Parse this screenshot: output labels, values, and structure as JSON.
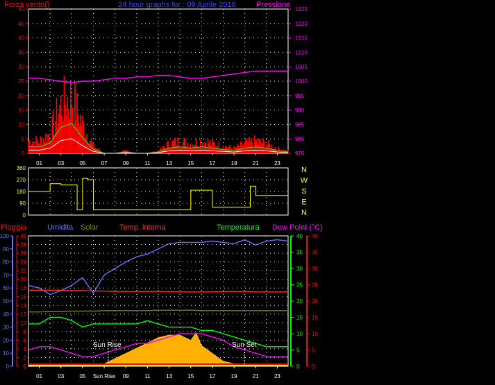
{
  "title": "24 hour graphs for : 09 Aprile 2016",
  "top_panel": {
    "left_label": "Forza vento()",
    "right_label": "Pressione",
    "left_ticks": [
      "0",
      "5",
      "10",
      "15",
      "20",
      "25",
      "30",
      "35",
      "40",
      "45",
      "50"
    ],
    "right_ticks": [
      "975",
      "980",
      "985",
      "990",
      "995",
      "1000",
      "1005",
      "1010",
      "1015",
      "1020",
      "1025"
    ],
    "colors": {
      "left": "#ff0000",
      "right": "#ff00ff",
      "title": "#4040ff"
    }
  },
  "middle_panel": {
    "left_ticks": [
      "0",
      "90",
      "180",
      "270",
      "360"
    ],
    "compass": [
      "N",
      "W",
      "S",
      "E",
      "N"
    ],
    "color": "#ffff00"
  },
  "bottom_panel": {
    "labels": {
      "pioggia": "Pioggia",
      "umidita": "Umidita",
      "solar": "Solar",
      "temp_interna": "Temp. interna",
      "temperatura": "Temperatura",
      "dew_point": "Dew Point (°C)"
    },
    "pioggia_ticks": [
      "0",
      "10",
      "20",
      "30",
      "40",
      "50",
      "60",
      "70",
      "80",
      "90",
      "100"
    ],
    "umidita_ticks": [
      "0",
      "2",
      "4",
      "6",
      "8",
      "10",
      "12",
      "14",
      "16",
      "18",
      "20",
      "22",
      "24",
      "26",
      "28",
      "30"
    ],
    "temperatura_ticks": [
      "0",
      "5",
      "10",
      "15",
      "20",
      "25",
      "30",
      "35",
      "40"
    ],
    "dew_ticks": [
      "0",
      "5",
      "10",
      "15",
      "20",
      "25",
      "30",
      "35",
      "40"
    ],
    "sun_rise": "Sun Rise",
    "sun_set": "Sun Set",
    "colors": {
      "pioggia": "#ff0000",
      "umidita": "#7070ff",
      "solar": "#808000",
      "temp_interna": "#ff3030",
      "temperatura": "#00ff00",
      "dew_point": "#ff00ff"
    }
  },
  "x_ticks": [
    "01",
    "03",
    "05",
    "07",
    "09",
    "11",
    "13",
    "15",
    "17",
    "19",
    "21",
    "23"
  ],
  "x_ticks_bottom": [
    "01",
    "03",
    "05",
    "Sun Rise",
    "09",
    "11",
    "13",
    "15",
    "17",
    "19",
    "21",
    "23"
  ],
  "chart_data": [
    {
      "type": "line",
      "x": [
        0,
        1,
        2,
        3,
        4,
        5,
        6,
        7,
        8,
        9,
        10,
        11,
        12,
        13,
        14,
        15,
        16,
        17,
        18,
        19,
        20,
        21,
        22,
        23,
        24
      ],
      "series": [
        {
          "name": "Pressione",
          "axis": "right",
          "values": [
            1001,
            1001,
            1000.5,
            1000,
            999.5,
            1000,
            1000,
            1000.5,
            1001,
            1001,
            1001.5,
            1001.5,
            1002,
            1002,
            1001.5,
            1001,
            1001,
            1001.5,
            1002,
            1002.5,
            1003,
            1003.5,
            1003.5,
            1003.5,
            1003.5
          ]
        },
        {
          "name": "Forza vento()",
          "axis": "left",
          "values": [
            5,
            5,
            8,
            20,
            23,
            12,
            3,
            0,
            0,
            1,
            0,
            0,
            1,
            4,
            5,
            4,
            5,
            4,
            3,
            2,
            4,
            5,
            4,
            2,
            1
          ]
        }
      ],
      "ylim_left": [
        0,
        50
      ],
      "ylim_right": [
        975,
        1025
      ]
    },
    {
      "type": "line",
      "x": [
        0,
        1,
        2,
        3,
        4,
        4.5,
        5,
        5.5,
        6,
        7,
        8,
        9,
        10,
        11,
        12,
        13,
        14,
        14.5,
        15,
        16,
        17,
        18,
        19,
        20,
        20.5,
        21,
        22,
        23,
        24
      ],
      "series": [
        {
          "values": [
            180,
            180,
            240,
            230,
            230,
            40,
            280,
            270,
            40,
            40,
            40,
            40,
            40,
            40,
            40,
            40,
            40,
            40,
            190,
            190,
            60,
            60,
            60,
            60,
            220,
            150,
            150,
            150,
            150
          ]
        }
      ],
      "ylim": [
        0,
        360
      ]
    },
    {
      "type": "line",
      "x": [
        0,
        1,
        2,
        3,
        4,
        5,
        6,
        7,
        8,
        9,
        10,
        11,
        12,
        13,
        14,
        15,
        16,
        17,
        18,
        19,
        20,
        21,
        22,
        23,
        24
      ],
      "series": [
        {
          "name": "Umidita",
          "axis": "pioggia",
          "values": [
            62,
            60,
            55,
            58,
            62,
            68,
            56,
            70,
            75,
            80,
            84,
            86,
            90,
            94,
            95,
            95,
            95,
            96,
            95,
            94,
            97,
            93,
            96,
            97,
            96
          ]
        },
        {
          "name": "Temp. interna",
          "axis": "umidita",
          "values": [
            17.5,
            17.5,
            17.5,
            17.5,
            17.4,
            17.4,
            17.3,
            17.3,
            17.2,
            17.2,
            17.2,
            17.2,
            17.2,
            17.2,
            17.1,
            17.1,
            17.1,
            17.1,
            17.2,
            17.2,
            17.2,
            17.1,
            17.1,
            17.1,
            17.1
          ]
        },
        {
          "name": "Solar",
          "axis": "umidita",
          "values": [
            12.5,
            12.5,
            12.6,
            12.6,
            12.7,
            12.7,
            12.7,
            12.8,
            12.8,
            12.8,
            12.8,
            12.8,
            12.9,
            12.9,
            12.9,
            12.9,
            12.8,
            12.8,
            12.8,
            12.8,
            12.8,
            12.8,
            12.8,
            12.8,
            12.8
          ]
        },
        {
          "name": "Temperatura",
          "axis": "temperatura",
          "values": [
            13,
            13,
            15,
            15,
            14,
            12,
            13,
            13,
            13,
            13,
            13,
            14,
            13,
            12,
            12,
            12,
            11,
            11,
            10,
            9,
            8,
            7,
            6,
            6,
            6
          ]
        },
        {
          "name": "Dew Point (°C)",
          "axis": "dew",
          "values": [
            5,
            6,
            6,
            5,
            4,
            3,
            3,
            4,
            5,
            6,
            7,
            7,
            8,
            9,
            10,
            10,
            10,
            9,
            8,
            6,
            5,
            4,
            3,
            3,
            3
          ]
        }
      ],
      "ylim_pioggia": [
        0,
        100
      ],
      "ylim_umidita": [
        0,
        30
      ],
      "ylim_temperatura": [
        0,
        40
      ],
      "ylim_dew": [
        0,
        40
      ]
    }
  ]
}
